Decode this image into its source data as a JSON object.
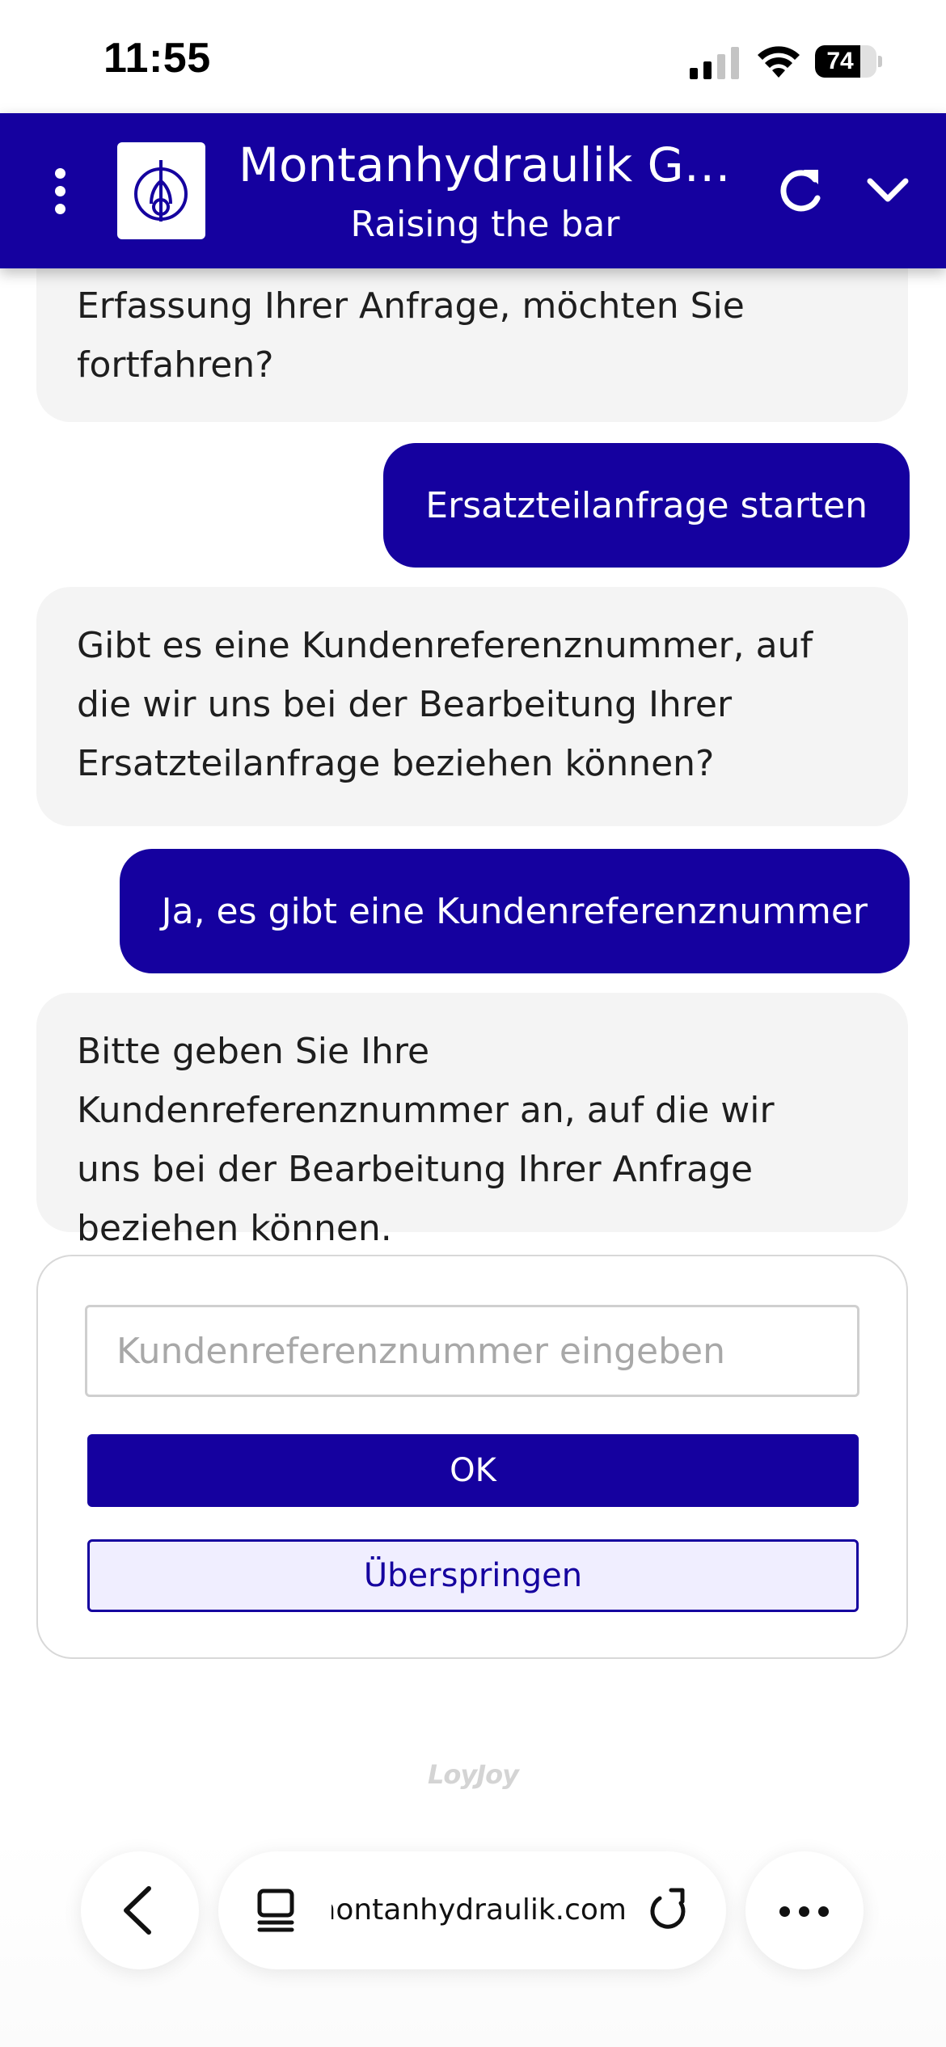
{
  "status_bar": {
    "time": "11:55",
    "battery_percent": 74,
    "battery_label": "74"
  },
  "header": {
    "title": "Montanhydraulik Gr...",
    "subtitle": "Raising the bar",
    "accent_color": "#15019f"
  },
  "chat": {
    "messages": [
      {
        "sender": "bot",
        "text": "Erfassung Ihrer Anfrage, möchten Sie fortfahren?"
      },
      {
        "sender": "user",
        "text": "Ersatzteilanfrage starten"
      },
      {
        "sender": "bot",
        "text": "Gibt es eine Kundenreferenznummer, auf die wir uns bei der Bearbeitung Ihrer Ersatzteilanfrage beziehen können?"
      },
      {
        "sender": "user",
        "text": "Ja, es gibt eine Kundenreferenznummer"
      },
      {
        "sender": "bot",
        "text": "Bitte geben Sie Ihre Kundenreferenznummer an, auf die wir uns bei der Bearbeitung Ihrer Anfrage beziehen können."
      }
    ]
  },
  "form": {
    "input_placeholder": "Kundenreferenznummer eingeben",
    "input_value": "",
    "ok_label": "OK",
    "skip_label": "Überspringen"
  },
  "branding": {
    "powered_by": "LoyJoy"
  },
  "browser": {
    "url": "montanhydraulik.com",
    "icons": [
      "back-icon",
      "tabs-icon",
      "reload-icon",
      "more-icon"
    ]
  }
}
